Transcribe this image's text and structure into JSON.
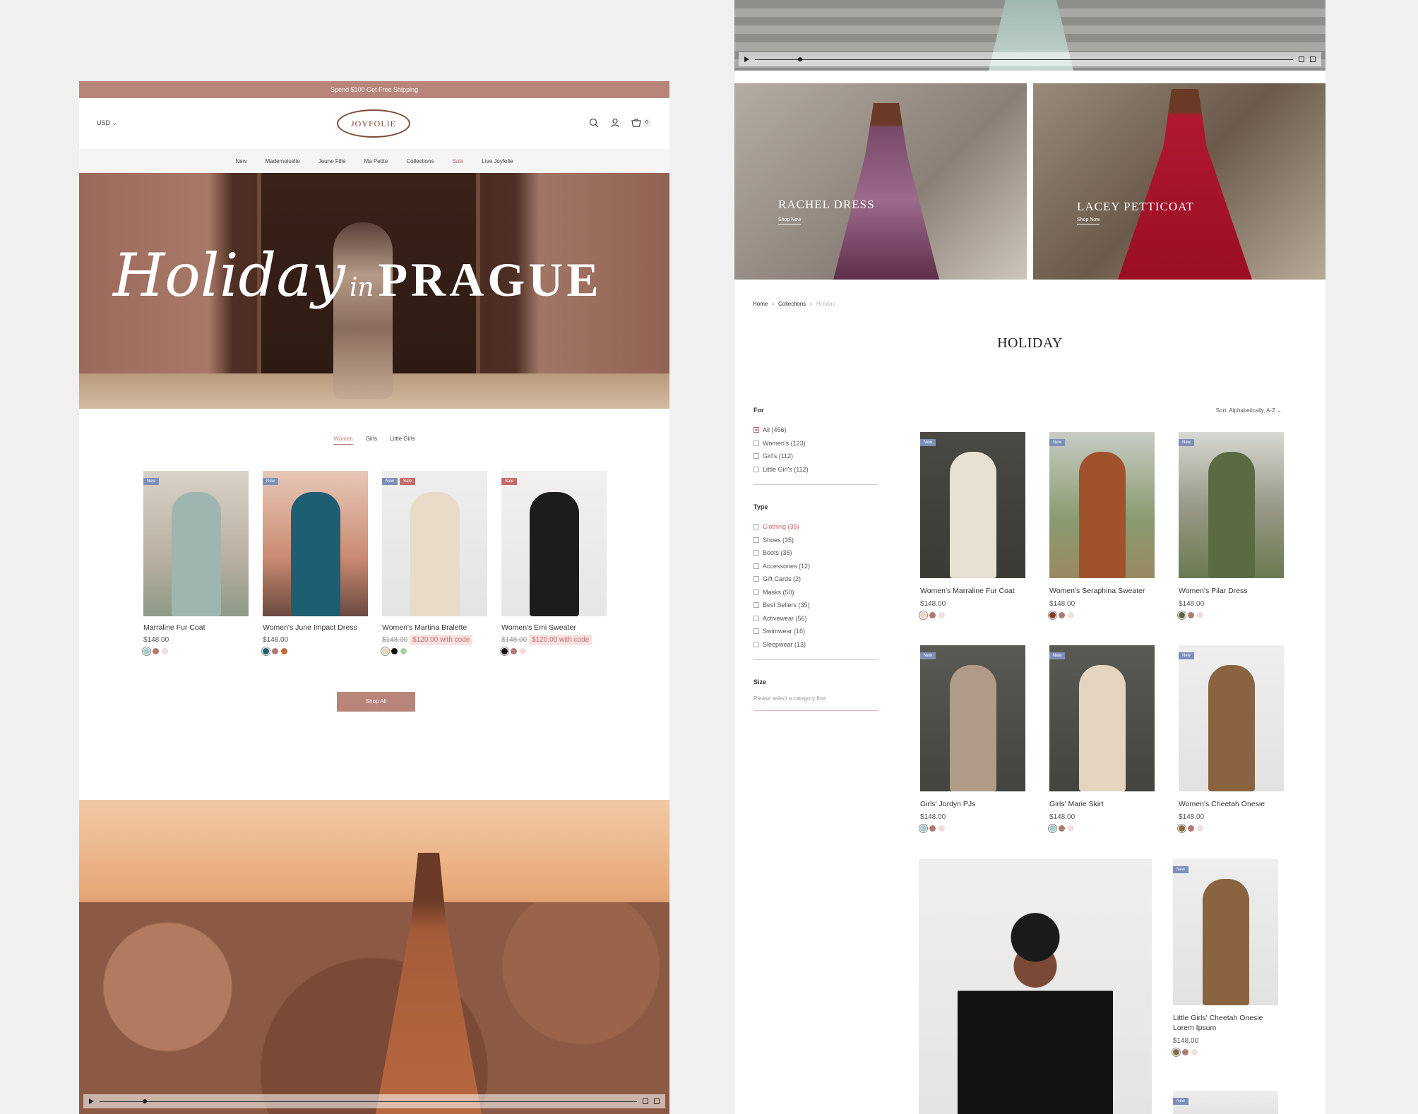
{
  "left_page": {
    "promo_text": "Spend $100 Get Free Shipping",
    "currency": "USD",
    "logo_text": "JOYFOLIE",
    "cart_count": "0",
    "nav": [
      {
        "label": "New",
        "sale": false
      },
      {
        "label": "Mademoiselle",
        "sale": false
      },
      {
        "label": "Jeune Fille",
        "sale": false
      },
      {
        "label": "Ma Petite",
        "sale": false
      },
      {
        "label": "Collections",
        "sale": false
      },
      {
        "label": "Sale",
        "sale": true
      },
      {
        "label": "Live Joyfolie",
        "sale": false
      }
    ],
    "hero": {
      "script": "Holiday",
      "connector": "in",
      "title": "PRAGUE"
    },
    "tabs": [
      {
        "label": "Women",
        "active": true
      },
      {
        "label": "Girls",
        "active": false
      },
      {
        "label": "Little Girls",
        "active": false
      }
    ],
    "products": [
      {
        "name": "Marraline Fur Coat",
        "price": "$148.00",
        "was": "",
        "code": "",
        "badges": [
          "New"
        ],
        "swatches": [
          "#a8cccc",
          "#b07a70",
          "#f2dede"
        ],
        "bg": "linear-gradient(180deg,#d9d2c8,#b9b0a0 60%,#8e9a86)",
        "fig": "#9fb6b0"
      },
      {
        "name": "Women's June Impact Dress",
        "price": "$148.00",
        "was": "",
        "code": "",
        "badges": [
          "New"
        ],
        "swatches": [
          "#1f5a70",
          "#b07a70",
          "#c06a3a"
        ],
        "bg": "linear-gradient(180deg,#e8c8b8,#c98a70 60%,#6a4a40)",
        "fig": "#1e5e72"
      },
      {
        "name": "Women's Martina Bralette",
        "price": "",
        "was": "$148.00",
        "code": "$120.00 with code",
        "badges": [
          "New",
          "Sale"
        ],
        "swatches": [
          "#e8d8c0",
          "#111111",
          "#a8d0a8"
        ],
        "bg": "linear-gradient(180deg,#eeeeee,#e4e4e4)",
        "fig": "#e8dcc8"
      },
      {
        "name": "Women's Emi Sweater",
        "price": "",
        "was": "$148.00",
        "code": "$120.00 with code",
        "badges": [
          "Sale"
        ],
        "swatches": [
          "#111111",
          "#b07a70",
          "#f2dede"
        ],
        "bg": "linear-gradient(180deg,#f2f0ee,#e8e6e4)",
        "fig": "#1c1c1c"
      }
    ],
    "shop_all": "Shop All"
  },
  "right_page": {
    "banners": [
      {
        "title": "RACHEL DRESS",
        "link": "Shop Now"
      },
      {
        "title": "LACEY PETTICOAT",
        "link": "Shop Now"
      }
    ],
    "breadcrumb": [
      "Home",
      "Collections",
      "Holiday"
    ],
    "page_title": "HOLIDAY",
    "sort_label": "Sort: Alphabetically, A-Z",
    "filters": {
      "for_title": "For",
      "for_options": [
        {
          "label": "All (456)",
          "checked": true
        },
        {
          "label": "Women's (123)",
          "checked": false
        },
        {
          "label": "Girl's (112)",
          "checked": false
        },
        {
          "label": "Little Girl's (112)",
          "checked": false
        }
      ],
      "type_title": "Type",
      "type_options": [
        {
          "label": "Clothing (35)",
          "checked": false
        },
        {
          "label": "Shoes (35)",
          "checked": false
        },
        {
          "label": "Boots (35)",
          "checked": false
        },
        {
          "label": "Accessories (12)",
          "checked": false
        },
        {
          "label": "Gift Cards (2)",
          "checked": false
        },
        {
          "label": "Masks (50)",
          "checked": false
        },
        {
          "label": "Best Sellers (35)",
          "checked": false
        },
        {
          "label": "Activewear (56)",
          "checked": false
        },
        {
          "label": "Swimwear (16)",
          "checked": false
        },
        {
          "label": "Sleepwear (13)",
          "checked": false
        }
      ],
      "size_title": "Size",
      "size_note": "Please select a category first"
    },
    "products": [
      {
        "name": "Women's Marraline Fur Coat",
        "price": "$148.00",
        "badge": "New",
        "swatches": [
          "#e8d8c0",
          "#b07a70",
          "#f2dede"
        ],
        "bg": "linear-gradient(180deg,#4a4a44,#3a3a36)",
        "fig": "#e8e0d0"
      },
      {
        "name": "Women's Seraphina Sweater",
        "price": "$148.00",
        "badge": "New",
        "swatches": [
          "#8a3a22",
          "#b07a70",
          "#f2dede"
        ],
        "bg": "linear-gradient(180deg,#c8ccc4,#8a9a70 60%,#9a8a60)",
        "fig": "#a0522d"
      },
      {
        "name": "Women's Pilar Dress",
        "price": "$148.00",
        "badge": "New",
        "swatches": [
          "#5a6a40",
          "#b07a70",
          "#f2dede"
        ],
        "bg": "linear-gradient(180deg,#d8d8d4,#9a9a88 50%,#6a7a50)",
        "fig": "#5a6b42"
      },
      {
        "name": "Girls' Jordyn PJs",
        "price": "$148.00",
        "badge": "New",
        "swatches": [
          "#a8cccc",
          "#b07a70",
          "#f2dede"
        ],
        "bg": "linear-gradient(180deg,#5a5a54,#44443e)",
        "fig": "#b09a88"
      },
      {
        "name": "Girls' Marie Skirt",
        "price": "$148.00",
        "badge": "New",
        "swatches": [
          "#a8cccc",
          "#b07a70",
          "#f2dede"
        ],
        "bg": "linear-gradient(180deg,#5a5a54,#44443e)",
        "fig": "#e4d4c0"
      },
      {
        "name": "Women's Cheetah Onesie",
        "price": "$148.00",
        "badge": "New",
        "swatches": [
          "#8a6a40",
          "#b07a70",
          "#f2dede"
        ],
        "bg": "linear-gradient(180deg,#eeeeee,#e2e2e2)",
        "fig": "#8a6440"
      },
      {
        "name": "Little Girls' Cheetah Onesie Lorem Ipsum",
        "price": "$148.00",
        "badge": "New",
        "swatches": [
          "#8a6a40",
          "#b07a70",
          "#f2dede"
        ],
        "bg": "linear-gradient(180deg,#eeeeee,#e2e2e2)",
        "fig": "#8a6440"
      }
    ],
    "partial_badge": "New"
  }
}
